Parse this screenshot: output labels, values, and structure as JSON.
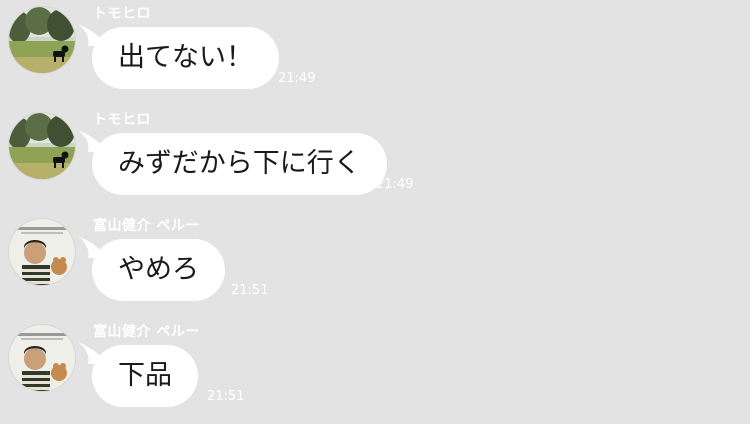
{
  "messages": [
    {
      "sender": "トモヒロ",
      "text": "出てない！",
      "time": "21:49",
      "avatar": "dog-park-avatar"
    },
    {
      "sender": "トモヒロ",
      "text": "みずだから下に行く",
      "time": "21:49",
      "avatar": "dog-park-avatar"
    },
    {
      "sender": "富山健介  ペルー",
      "text": "やめろ",
      "time": "21:51",
      "avatar": "person-avatar"
    },
    {
      "sender": "富山健介  ペルー",
      "text": "下品",
      "time": "21:51",
      "avatar": "person-avatar"
    }
  ],
  "colors": {
    "background": "#e3e3e3",
    "bubble": "#ffffff",
    "meta_text": "#ffffff"
  }
}
